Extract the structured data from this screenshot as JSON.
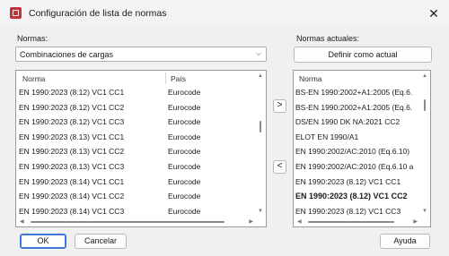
{
  "window": {
    "title": "Configuración de lista de normas",
    "close_glyph": "✕"
  },
  "left": {
    "label": "Normas:",
    "combo_value": "Combinaciones de cargas",
    "combo_arrow": "⌵",
    "columns": [
      "Norma",
      "País"
    ],
    "rows": [
      {
        "norma": "EN 1990:2023 (8.12) VC1 CC1",
        "pais": "Eurocode"
      },
      {
        "norma": "EN 1990:2023 (8.12) VC1 CC2",
        "pais": "Eurocode"
      },
      {
        "norma": "EN 1990:2023 (8.12) VC1 CC3",
        "pais": "Eurocode"
      },
      {
        "norma": "EN 1990:2023 (8.13) VC1 CC1",
        "pais": "Eurocode"
      },
      {
        "norma": "EN 1990:2023 (8.13) VC1 CC2",
        "pais": "Eurocode"
      },
      {
        "norma": "EN 1990:2023 (8.13) VC1 CC3",
        "pais": "Eurocode"
      },
      {
        "norma": "EN 1990:2023 (8.14) VC1 CC1",
        "pais": "Eurocode"
      },
      {
        "norma": "EN 1990:2023 (8.14) VC1 CC2",
        "pais": "Eurocode"
      },
      {
        "norma": "EN 1990:2023 (8.14) VC1 CC3",
        "pais": "Eurocode"
      }
    ]
  },
  "transfer": {
    "add_label": ">",
    "remove_label": "<"
  },
  "right": {
    "label": "Normas actuales:",
    "define_button": "Definir como actual",
    "column": "Norma",
    "rows": [
      "BS-EN 1990:2002+A1:2005 (Eq.6.",
      "BS-EN 1990:2002+A1:2005 (Eq.6.",
      "DS/EN 1990 DK NA:2021 CC2",
      "ELOT EN 1990/A1",
      "EN 1990:2002/AC:2010  (Eq.6.10)",
      "EN 1990:2002/AC:2010  (Eq.6.10 a",
      "EN 1990:2023 (8.12) VC1 CC1",
      "EN 1990:2023 (8.12) VC1 CC2",
      "EN 1990:2023 (8.12) VC1 CC3"
    ],
    "current_index": 7
  },
  "footer": {
    "ok": "OK",
    "cancel": "Cancelar",
    "help": "Ayuda"
  },
  "scroll": {
    "up_glyph": "▲",
    "down_glyph": "▼",
    "left_glyph": "◀",
    "right_glyph": "▶"
  }
}
